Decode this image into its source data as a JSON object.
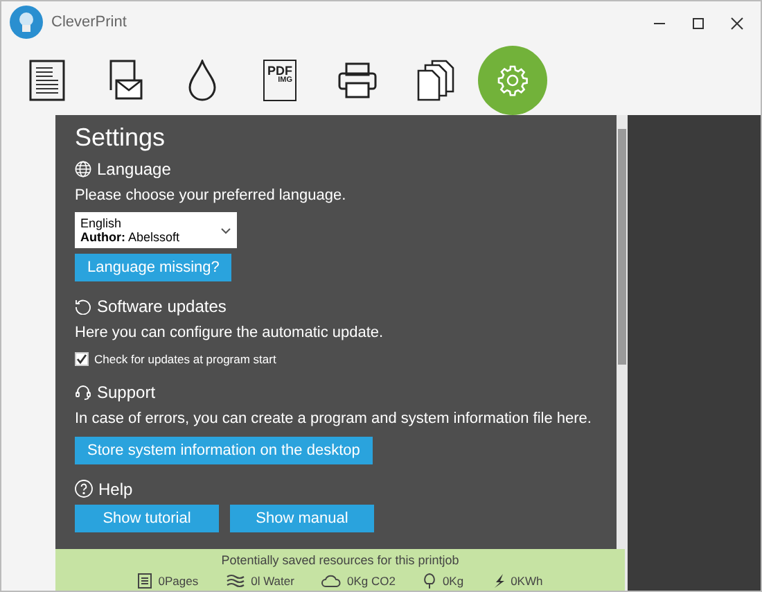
{
  "window": {
    "title": "CleverPrint"
  },
  "toolbar": [
    {
      "kind": "document",
      "selected": false
    },
    {
      "kind": "mail",
      "selected": false
    },
    {
      "kind": "drop",
      "selected": false
    },
    {
      "kind": "pdf",
      "selected": false,
      "label": "PDF",
      "sublabel": "IMG"
    },
    {
      "kind": "printer",
      "selected": false
    },
    {
      "kind": "copies",
      "selected": false
    },
    {
      "kind": "settings",
      "selected": true
    }
  ],
  "settings": {
    "title": "Settings",
    "sections": [
      {
        "kind": "language",
        "heading": "Language",
        "text": "Please choose your preferred language.",
        "select": {
          "language": "English",
          "author_label": "Author:",
          "author": "Abelssoft"
        },
        "buttons": [
          "Language missing?"
        ]
      },
      {
        "kind": "updates",
        "heading": "Software updates",
        "text": "Here you can configure the automatic update.",
        "checkbox": {
          "label": "Check for updates at program start",
          "checked": true
        }
      },
      {
        "kind": "support",
        "heading": "Support",
        "text": "In case of errors, you can create a program and system information file here.",
        "buttons": [
          "Store system information on the desktop"
        ]
      },
      {
        "kind": "help",
        "heading": "Help",
        "buttons": [
          "Show tutorial",
          "Show manual"
        ]
      }
    ]
  },
  "footer": {
    "title": "Potentially saved resources for this printjob",
    "items": [
      {
        "kind": "pages",
        "text": "0Pages"
      },
      {
        "kind": "water",
        "text": "0l Water"
      },
      {
        "kind": "co2",
        "text": "0Kg CO2"
      },
      {
        "kind": "tree",
        "text": "0Kg"
      },
      {
        "kind": "energy",
        "text": "0KWh"
      }
    ]
  }
}
